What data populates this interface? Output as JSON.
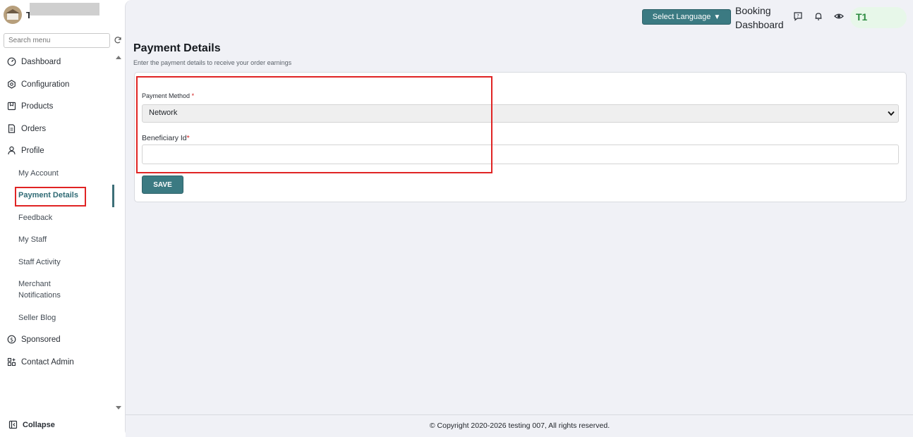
{
  "sidebar": {
    "brand_initial": "T",
    "search_placeholder": "Search menu",
    "items": [
      {
        "label": "Dashboard",
        "icon": "dashboard-gauge-icon"
      },
      {
        "label": "Configuration",
        "icon": "config-hex-icon"
      },
      {
        "label": "Products",
        "icon": "products-box-icon"
      },
      {
        "label": "Orders",
        "icon": "orders-doc-icon"
      },
      {
        "label": "Profile",
        "icon": "profile-user-icon"
      }
    ],
    "profile_subitems": [
      {
        "label": "My Account"
      },
      {
        "label": "Payment Details"
      },
      {
        "label": "Feedback"
      },
      {
        "label": "My Staff"
      },
      {
        "label": "Staff Activity"
      },
      {
        "label": "Merchant Notifications"
      },
      {
        "label": "Seller Blog"
      }
    ],
    "bottom_items": [
      {
        "label": "Sponsored",
        "icon": "sponsored-badge-icon"
      },
      {
        "label": "Contact Admin",
        "icon": "contact-grid-icon"
      }
    ],
    "collapse_label": "Collapse",
    "active_item": "Payment Details"
  },
  "header": {
    "language_button": "Select Language",
    "booking_dashboard": "Booking Dashboard",
    "user_initials": "T1"
  },
  "main": {
    "title": "Payment Details",
    "subtitle": "Enter the payment details to receive your order earnings",
    "form": {
      "payment_method_label": "Payment Method",
      "payment_method_value": "Network",
      "beneficiary_label": "Beneficiary Id",
      "beneficiary_value": "",
      "required_mark": "*",
      "save_label": "SAVE"
    }
  },
  "footer": {
    "copyright": "© Copyright 2020-2026 testing 007, All rights reserved."
  },
  "colors": {
    "accent": "#3b7a82",
    "highlight": "#e02424",
    "required": "#d21c1c",
    "badge_bg": "#e7f7e9",
    "badge_text": "#2a8a3e"
  }
}
